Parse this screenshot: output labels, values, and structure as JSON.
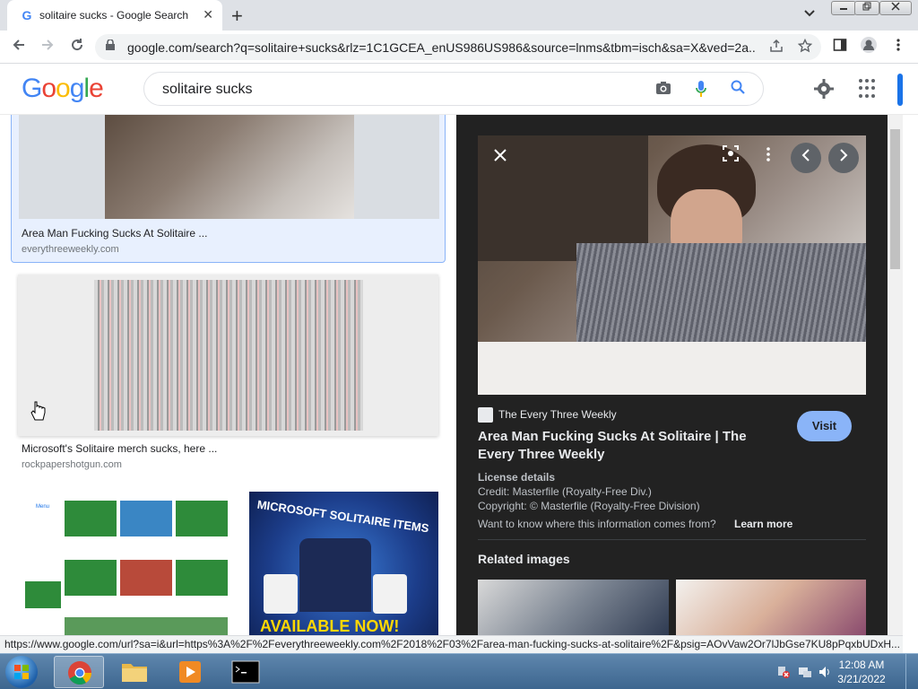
{
  "browser": {
    "tab_title": "solitaire sucks - Google Search",
    "favicon_letter": "G",
    "tab_close": "✕",
    "new_tab": "+",
    "tab_list": "⌄",
    "url": "google.com/search?q=solitaire+sucks&rlz=1C1GCEA_enUS986US986&source=lnms&tbm=isch&sa=X&ved=2a..."
  },
  "google": {
    "logo": [
      "G",
      "o",
      "o",
      "g",
      "l",
      "e"
    ],
    "logo_colors": [
      "#4285f4",
      "#ea4335",
      "#fbbc05",
      "#4285f4",
      "#34a853",
      "#ea4335"
    ],
    "query": "solitaire sucks"
  },
  "results": [
    {
      "caption": "Area Man Fucking Sucks At Solitaire ...",
      "source": "everythreeweekly.com"
    },
    {
      "caption": "Microsoft's Solitaire merch sucks, here ...",
      "source": "rockpapershotgun.com"
    }
  ],
  "thumb_texts": {
    "merch_banner": "MICROSOFT SOLITAIRE ITEMS",
    "merch_bottom": "AVAILABLE NOW!",
    "games_menu": "Menu"
  },
  "preview": {
    "site_name": "The Every Three Weekly",
    "title": "Area Man Fucking Sucks At Solitaire | The Every Three Weekly",
    "visit": "Visit",
    "license_heading": "License details",
    "credit": "Credit: Masterfile (Royalty-Free Div.)",
    "copyright": "Copyright: © Masterfile (Royalty-Free Division)",
    "want_to_know": "Want to know where this information comes from?",
    "learn_more": "Learn more",
    "related": "Related images"
  },
  "status_url": "https://www.google.com/url?sa=i&url=https%3A%2F%2Feverythreeweekly.com%2F2018%2F03%2Farea-man-fucking-sucks-at-solitaire%2F&psig=AOvVaw2Or7lJbGse7KU8pPqxbUDxH...",
  "taskbar": {
    "time": "12:08 AM",
    "date": "3/21/2022"
  }
}
